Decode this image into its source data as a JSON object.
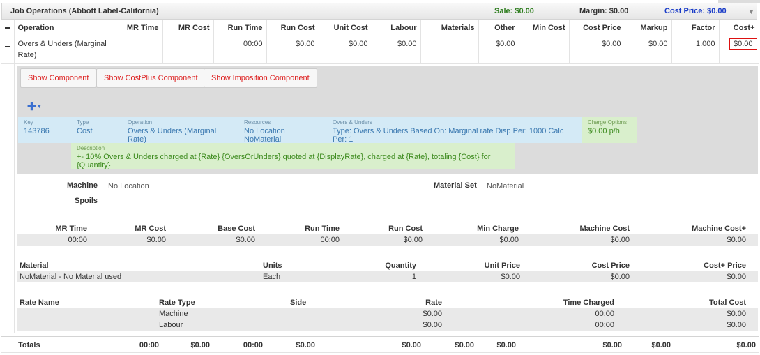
{
  "header": {
    "title": "Job Operations (Abbott Label-California)",
    "sale": "Sale: $0.00",
    "margin": "Margin: $0.00",
    "cost_price": "Cost Price: $0.00"
  },
  "grid": {
    "columns": [
      "Operation",
      "MR Time",
      "MR Cost",
      "Run Time",
      "Run Cost",
      "Unit Cost",
      "Labour",
      "Materials",
      "Other",
      "Min Cost",
      "Cost Price",
      "Markup",
      "Factor",
      "Cost+"
    ],
    "row": {
      "operation": "Overs & Unders (Marginal Rate)",
      "mr_time": "",
      "mr_cost": "",
      "run_time": "00:00",
      "run_cost": "$0.00",
      "unit_cost": "$0.00",
      "labour": "$0.00",
      "materials": "",
      "other": "$0.00",
      "min_cost": "",
      "cost_price": "$0.00",
      "markup": "$0.00",
      "factor": "1.000",
      "cost_plus": "$0.00"
    }
  },
  "component_buttons": {
    "show_component": "Show Component",
    "show_costplus": "Show CostPlus Component",
    "show_imposition": "Show Imposition Component"
  },
  "component": {
    "key_label": "Key",
    "key": "143786",
    "type_label": "Type",
    "type": "Cost",
    "operation_label": "Operation",
    "operation": "Overs & Unders (Marginal Rate)",
    "resources_label": "Resources",
    "resources": "No Location NoMaterial",
    "overs_label": "Overs & Unders",
    "overs": "Type: Overs & Unders Based On: Marginal rate Disp Per: 1000 Calc Per: 1",
    "charge_label": "Charge Options",
    "charge": "$0.00 p/h",
    "description_label": "Description",
    "description": "+- 10% Overs & Unders charged at {Rate} {OversOrUnders} quoted at {DisplayRate}, charged at {Rate}, totaling {Cost} for {Quantity}"
  },
  "machine": {
    "machine_label": "Machine",
    "machine": "No Location",
    "spoils_label": "Spoils",
    "material_set_label": "Material Set",
    "material_set": "NoMaterial"
  },
  "costs_table": {
    "headers": [
      "MR Time",
      "MR Cost",
      "Base Cost",
      "Run Time",
      "Run Cost",
      "Min Charge",
      "Machine Cost",
      "Machine Cost+"
    ],
    "values": [
      "00:00",
      "$0.00",
      "$0.00",
      "00:00",
      "$0.00",
      "$0.00",
      "$0.00",
      "$0.00"
    ]
  },
  "material_table": {
    "headers": [
      "Material",
      "Units",
      "Quantity",
      "Unit Price",
      "Cost Price",
      "Cost+ Price"
    ],
    "values": [
      "NoMaterial - No Material used",
      "Each",
      "1",
      "$0.00",
      "$0.00",
      "$0.00"
    ]
  },
  "rate_table": {
    "headers": [
      "Rate Name",
      "Rate Type",
      "Side",
      "Rate",
      "Time Charged",
      "Total Cost"
    ],
    "rows": [
      [
        "",
        "Machine",
        "",
        "$0.00",
        "00:00",
        "$0.00"
      ],
      [
        "",
        "Labour",
        "",
        "$0.00",
        "00:00",
        "$0.00"
      ]
    ]
  },
  "totals": {
    "label": "Totals",
    "mr_time": "00:00",
    "mr_cost": "$0.00",
    "run_time": "00:00",
    "run_cost": "$0.00",
    "labour": "$0.00",
    "materials": "$0.00",
    "other": "$0.00",
    "cost_price": "$0.00",
    "markup": "$0.00",
    "cost_plus": "$0.00"
  },
  "colors": {
    "sale": "#2e7d1e",
    "cost_price": "#1a3cc7",
    "button_text": "#d22222",
    "info_blue": "#d4eaf6",
    "info_green": "#d9efcc"
  }
}
